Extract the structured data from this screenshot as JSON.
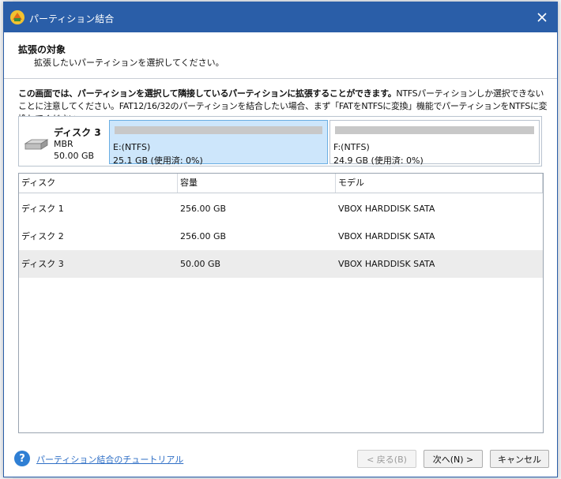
{
  "dialog": {
    "title": "パーティション結合",
    "header_title": "拡張の対象",
    "header_subtitle": "拡張したいパーティションを選択してください。",
    "info_bold": "この画面では、パーティションを選択して隣接しているパーティションに拡張することができます。",
    "info_normal": "NTFSパーティションしか選択できないことに注意してください。FAT12/16/32のパーティションを結合したい場合、まず「FATをNTFSに変換」機能でパーティションをNTFSに変換してください。"
  },
  "disk_map": {
    "disk_name": "ディスク 3",
    "disk_type": "MBR",
    "disk_size": "50.00 GB",
    "partitions": [
      {
        "label": "E:(NTFS)",
        "info": "25.1 GB (使用済: 0%)",
        "used_fraction": 0.0,
        "selected": true
      },
      {
        "label": "F:(NTFS)",
        "info": "24.9 GB (使用済: 0%)",
        "used_fraction": 0.0,
        "selected": false
      }
    ]
  },
  "table": {
    "columns": [
      "ディスク",
      "容量",
      "モデル"
    ],
    "rows": [
      {
        "disk": "ディスク 1",
        "capacity": "256.00 GB",
        "model": "VBOX HARDDISK SATA"
      },
      {
        "disk": "ディスク 2",
        "capacity": "256.00 GB",
        "model": "VBOX HARDDISK SATA"
      },
      {
        "disk": "ディスク 3",
        "capacity": "50.00 GB",
        "model": "VBOX HARDDISK SATA"
      }
    ],
    "selected_row": 2
  },
  "footer": {
    "help_link": "パーティション結合のチュートリアル",
    "back_label": "< 戻る(B)",
    "next_label": "次へ(N) >",
    "cancel_label": "キャンセル"
  },
  "colors": {
    "titlebar": "#2a5ea8",
    "selected_partition": "#cde6fb",
    "link": "#2f6fc6"
  }
}
